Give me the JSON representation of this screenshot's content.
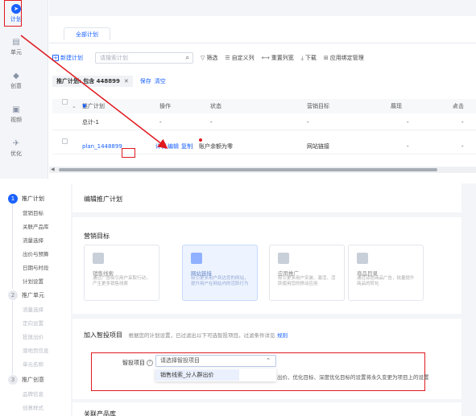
{
  "top": {
    "rail": [
      {
        "label": "计划",
        "icon": "plan-icon",
        "active": true
      },
      {
        "label": "单元",
        "icon": "unit-icon",
        "active": false
      },
      {
        "label": "创意",
        "icon": "creative-icon",
        "active": false
      },
      {
        "label": "视频",
        "icon": "video-icon",
        "active": false
      },
      {
        "label": "优化",
        "icon": "optimize-icon",
        "active": false
      }
    ],
    "tab_all": "全部计划",
    "toolbar": {
      "new_plan": "新建计划",
      "search_placeholder": "请搜索计划",
      "filter": "筛选",
      "custom_columns": "自定义列",
      "reset_width": "重置列宽",
      "download": "下载",
      "app_binding": "应用绑定管理"
    },
    "filter_chip": "推广计划: 包含 448899",
    "save": "保存",
    "clear": "清空",
    "columns": [
      "推广计划",
      "操作",
      "状态",
      "营销目标",
      "展现",
      "点击"
    ],
    "sort_marks": [
      "◆",
      "◆"
    ],
    "total_row": {
      "name": "总计-1",
      "op": "-",
      "status": "-",
      "goal": "-",
      "show": "-",
      "click": "-"
    },
    "plan_row": {
      "name": "plan_1448899",
      "op_detail": "详情",
      "op_edit": "编辑",
      "op_copy": "复制",
      "status": "账户余额为零",
      "goal": "网站链接",
      "show": "-",
      "click": "-"
    }
  },
  "bottom": {
    "steps": [
      {
        "num": "1",
        "title": "推广计划",
        "items": [
          "营销目标",
          "关联产品库",
          "流量选择",
          "出价与预算",
          "日期与时段",
          "计划设置"
        ]
      },
      {
        "num": "2",
        "title": "推广单元",
        "items": [
          "流量选择",
          "定向设置",
          "投放出价",
          "落地页信息",
          "单元名称"
        ]
      },
      {
        "num": "3",
        "title": "推广创意",
        "items": [
          "品牌信息",
          "创意样式"
        ]
      }
    ],
    "page_title": "编辑推广计划",
    "goal_section_title": "营销目标",
    "goals": [
      {
        "name": "销售线索",
        "desc": "通过广告吸引用户采取行动，产生更多销售线索",
        "selected": false
      },
      {
        "name": "网站链接",
        "desc": "吸引更多用户到达您的网站，提升用户在网站内的活跃行为",
        "selected": true
      },
      {
        "name": "应用推广",
        "desc": "吸引更多用户安装、激活、活跃使用您的移动应用",
        "selected": false
      },
      {
        "name": "商品目录",
        "desc": "通过动态商品广告，批量提升商品的转化",
        "selected": false
      }
    ],
    "smart_title": "加入智投项目",
    "smart_desc": "根据您的计划设置，已过滤出以下可选智投项目。过滤条件详见",
    "smart_rule_link": "规则",
    "field_label": "智投项目",
    "select_placeholder": "请选择智投项目",
    "dropdown_option": "销售线索_分人群出价",
    "warn_text": "出价、优化目标、深度优化目标的设置将永久变更为项目上的设置",
    "next_section_title": "关联产品库"
  }
}
